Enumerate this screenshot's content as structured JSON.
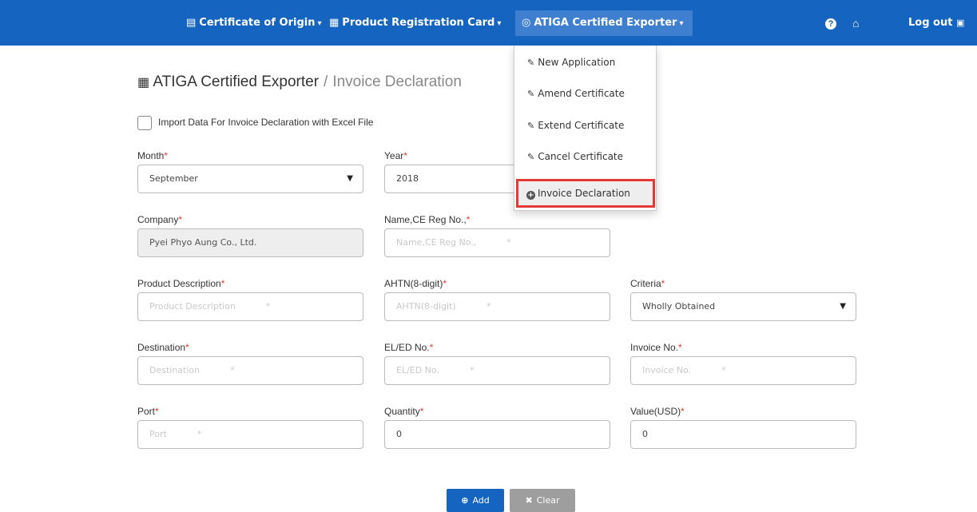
{
  "navbar": {
    "background": "#1565c0",
    "items": [
      {
        "label": "Certificate of Origin",
        "icon": "certificate-icon"
      },
      {
        "label": "Product Registration Card",
        "icon": "id-card-icon"
      },
      {
        "label": "ATIGA Certified Exporter",
        "icon": "badge-icon"
      }
    ],
    "logout_label": "Log out"
  },
  "dropdown": {
    "items": [
      {
        "label": "New Application",
        "icon": "pencil-icon"
      },
      {
        "label": "Amend Certificate",
        "icon": "pencil-icon"
      },
      {
        "label": "Extend Certificate",
        "icon": "pencil-icon"
      },
      {
        "label": "Cancel Certificate",
        "icon": "pencil-icon"
      },
      {
        "label": "Invoice Declaration",
        "icon": "plus-circle-icon"
      }
    ],
    "highlight_color": "#e53935"
  },
  "page": {
    "title": "ATIGA Certified Exporter",
    "separator": "/",
    "subtitle": "Invoice Declaration",
    "import_label": "Import Data For Invoice Declaration with Excel File"
  },
  "form": {
    "month": {
      "label": "Month",
      "value": "September"
    },
    "year": {
      "label": "Year",
      "value": "2018"
    },
    "company": {
      "label": "Company",
      "value": "Pyei Phyo Aung Co., Ltd."
    },
    "name_ce": {
      "label": "Name,CE Reg No.,",
      "placeholder": "Name,CE Reg No.,"
    },
    "product_description": {
      "label": "Product Description",
      "placeholder": "Product Description"
    },
    "ahtn": {
      "label": "AHTN(8-digit)",
      "placeholder": "AHTN(8-digit)"
    },
    "criteria": {
      "label": "Criteria",
      "value": "Wholly Obtained"
    },
    "destination": {
      "label": "Destination",
      "placeholder": "Destination"
    },
    "el_ed": {
      "label": "EL/ED No.",
      "placeholder": "EL/ED No."
    },
    "invoice": {
      "label": "Invoice No.",
      "placeholder": "Invoice No."
    },
    "port": {
      "label": "Port",
      "placeholder": "Port"
    },
    "quantity": {
      "label": "Quantity",
      "value": "0"
    },
    "value_usd": {
      "label": "Value(USD)",
      "value": "0"
    },
    "required_mark": "*"
  },
  "buttons": {
    "add": "Add",
    "clear": "Clear"
  }
}
